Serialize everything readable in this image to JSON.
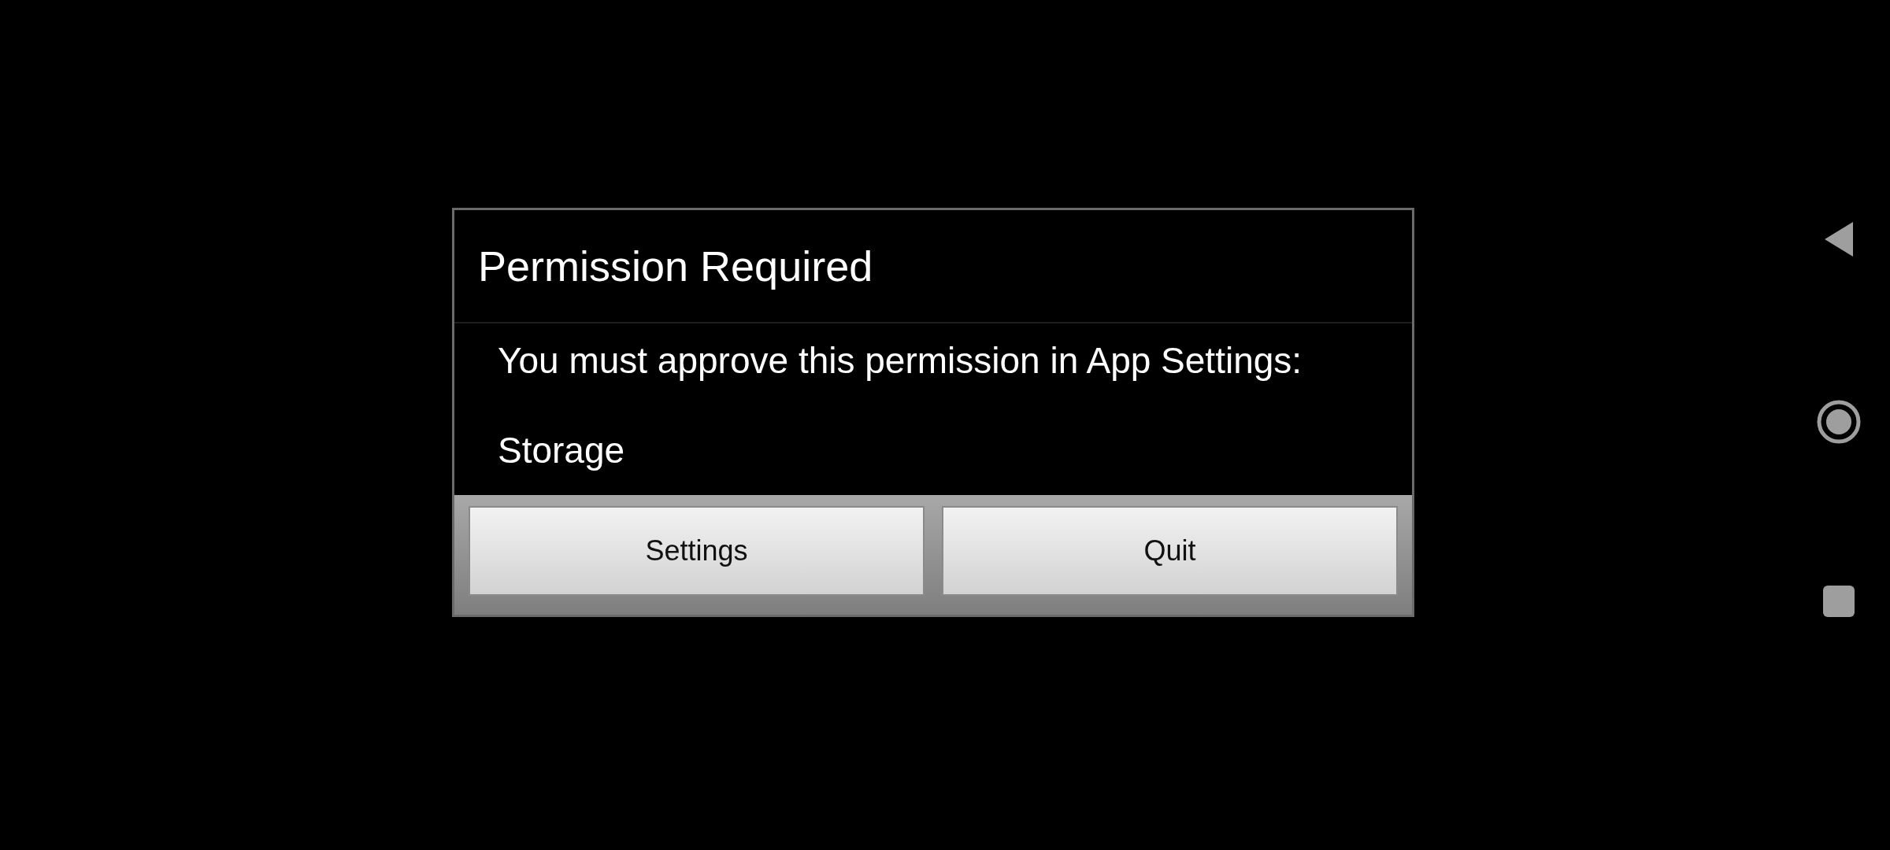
{
  "dialog": {
    "title": "Permission Required",
    "message": "You must approve this permission in App Settings:",
    "permission": "Storage",
    "buttons": [
      "Settings",
      "Quit"
    ]
  },
  "navigation_bar": {
    "buttons": [
      {
        "kind": "back"
      },
      {
        "kind": "home"
      },
      {
        "kind": "recents"
      }
    ]
  }
}
